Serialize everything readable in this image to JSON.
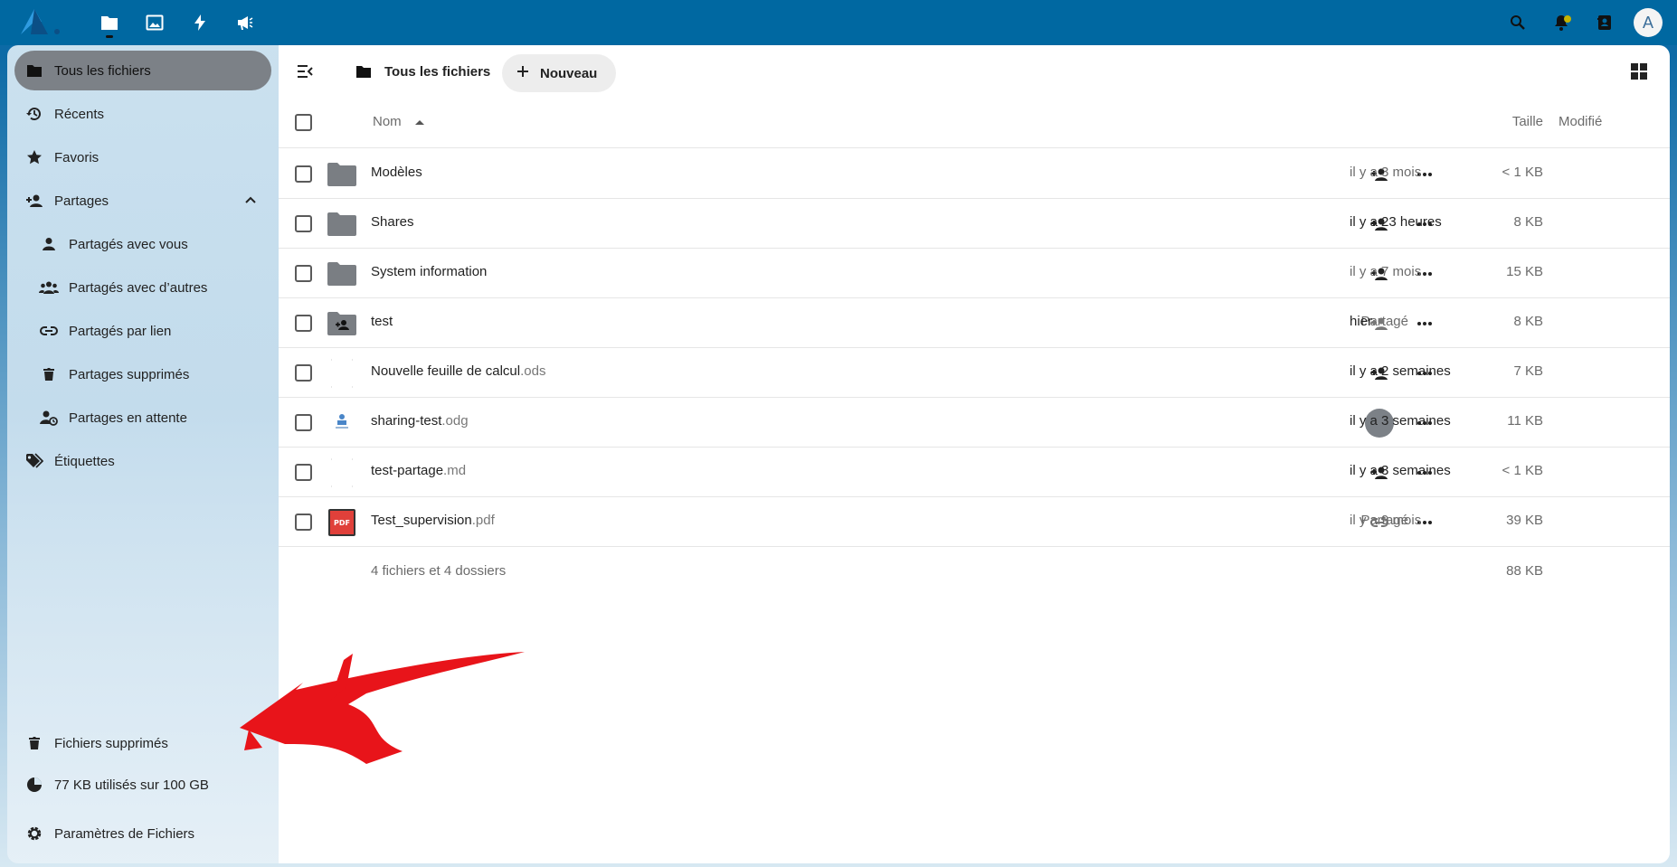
{
  "topbar": {
    "apps": [
      {
        "name": "files",
        "icon": "folder-icon",
        "active": true
      },
      {
        "name": "photos",
        "icon": "image-icon",
        "active": false
      },
      {
        "name": "activity",
        "icon": "lightning-icon",
        "active": false
      },
      {
        "name": "announcements",
        "icon": "megaphone-icon",
        "active": false
      }
    ],
    "avatar_letter": "A"
  },
  "sidebar": {
    "items": [
      {
        "label": "Tous les fichiers",
        "icon": "folder-icon"
      },
      {
        "label": "Récents",
        "icon": "history-icon"
      },
      {
        "label": "Favoris",
        "icon": "star-icon"
      },
      {
        "label": "Partages",
        "icon": "share-icon"
      },
      {
        "label": "Partagés avec vous",
        "icon": "person-icon"
      },
      {
        "label": "Partagés avec d’autres",
        "icon": "people-icon"
      },
      {
        "label": "Partagés par lien",
        "icon": "link-icon"
      },
      {
        "label": "Partages supprimés",
        "icon": "trash-icon"
      },
      {
        "label": "Partages en attente",
        "icon": "pending-share-icon"
      },
      {
        "label": "Étiquettes",
        "icon": "tags-icon"
      }
    ],
    "bottom": {
      "trash": "Fichiers supprimés",
      "quota": "77 KB utilisés sur 100 GB",
      "settings": "Paramètres de Fichiers"
    }
  },
  "toolbar": {
    "breadcrumb": "Tous les fichiers",
    "new_label": "Nouveau"
  },
  "table": {
    "headers": {
      "name": "Nom",
      "size": "Taille",
      "modified": "Modifié"
    },
    "rows": [
      {
        "name": "Modèles",
        "ext": "",
        "type": "folder",
        "shared_label": "",
        "size": "< 1 KB",
        "modified": "il y a 3 mois"
      },
      {
        "name": "Shares",
        "ext": "",
        "type": "folder",
        "shared_label": "",
        "size": "8 KB",
        "modified": "il y a 23 heures"
      },
      {
        "name": "System information",
        "ext": "",
        "type": "folder",
        "shared_label": "",
        "size": "15 KB",
        "modified": "il y a 7 mois"
      },
      {
        "name": "test",
        "ext": "",
        "type": "shared-folder",
        "shared_label": "Partagé",
        "size": "8 KB",
        "modified": "hier"
      },
      {
        "name": "Nouvelle feuille de calcul",
        "ext": ".ods",
        "type": "file",
        "shared_label": "",
        "size": "7 KB",
        "modified": "il y a 2 semaines"
      },
      {
        "name": "sharing-test",
        "ext": ".odg",
        "type": "drawing",
        "shared_label": "",
        "size": "11 KB",
        "modified": "il y a 3 semaines"
      },
      {
        "name": "test-partage",
        "ext": ".md",
        "type": "file",
        "shared_label": "",
        "size": "< 1 KB",
        "modified": "il y a 3 semaines"
      },
      {
        "name": "Test_supervision",
        "ext": ".pdf",
        "type": "pdf",
        "shared_label": "Partagé",
        "size": "39 KB",
        "modified": "il y a 9 mois"
      }
    ],
    "summary": "4 fichiers et 4 dossiers",
    "total_size": "88 KB"
  },
  "colors": {
    "topbar": "#0068a1",
    "active_nav": "#7c8187",
    "annotation_arrow": "#e8141a"
  }
}
